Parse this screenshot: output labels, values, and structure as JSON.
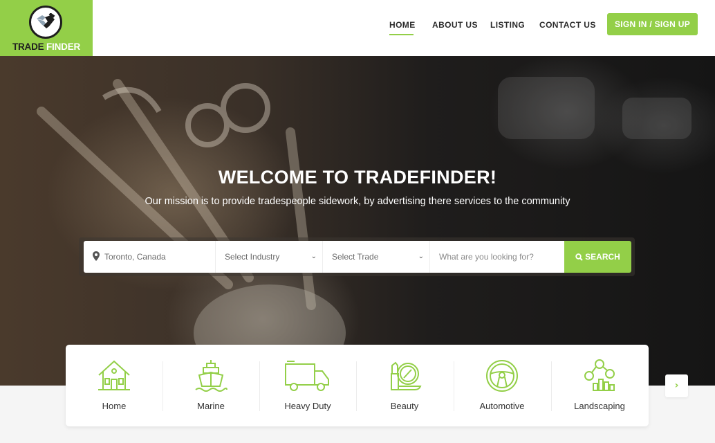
{
  "brand": {
    "logo_word1": "TRADE",
    "logo_word2": "FINDER",
    "logo_icon": "handshake-icon",
    "accent_color": "#93cf48"
  },
  "nav": {
    "items": [
      {
        "label": "HOME",
        "active": true
      },
      {
        "label": "ABOUT US",
        "active": false
      },
      {
        "label": "LISTING",
        "active": false
      },
      {
        "label": "CONTACT US",
        "active": false
      }
    ],
    "signin_label": "SIGN IN / SIGN UP"
  },
  "hero": {
    "title": "WELCOME TO TRADEFINDER!",
    "subtitle": "Our mission is to provide tradespeople sidework, by advertising there services to the community"
  },
  "search": {
    "location_value": "Toronto, Canada",
    "location_icon": "map-pin-icon",
    "industry_selected": "Select Industry",
    "trade_selected": "Select Trade",
    "query_placeholder": "What are you looking for?",
    "button_label": "SEARCH",
    "button_icon": "search-icon"
  },
  "categories": {
    "items": [
      {
        "label": "Home",
        "icon": "house-icon"
      },
      {
        "label": "Marine",
        "icon": "ship-icon"
      },
      {
        "label": "Heavy Duty",
        "icon": "truck-icon"
      },
      {
        "label": "Beauty",
        "icon": "lipstick-mirror-icon"
      },
      {
        "label": "Automotive",
        "icon": "steering-wheel-icon"
      },
      {
        "label": "Landscaping",
        "icon": "money-chart-icon"
      }
    ],
    "next_icon": "chevron-right-icon"
  }
}
